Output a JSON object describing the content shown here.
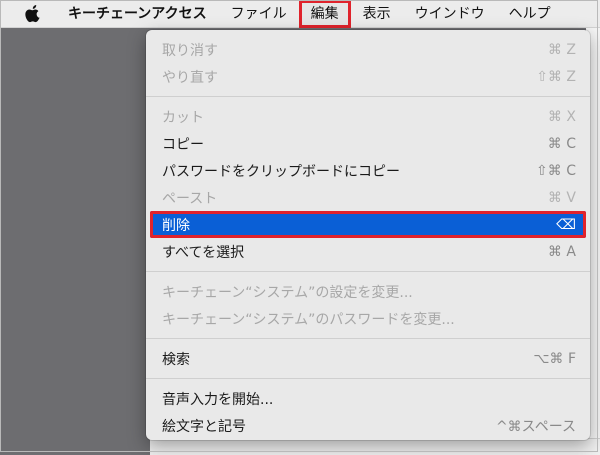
{
  "menubar": {
    "app_name": "キーチェーンアクセス",
    "menus": [
      "ファイル",
      "編集",
      "表示",
      "ウインドウ",
      "ヘルプ"
    ],
    "active_menu": "編集"
  },
  "edit_menu": {
    "undo": {
      "label": "取り消す",
      "shortcut": "⌘ Z",
      "enabled": false
    },
    "redo": {
      "label": "やり直す",
      "shortcut": "⇧⌘ Z",
      "enabled": false
    },
    "cut": {
      "label": "カット",
      "shortcut": "⌘ X",
      "enabled": false
    },
    "copy": {
      "label": "コピー",
      "shortcut": "⌘ C",
      "enabled": true
    },
    "copy_password": {
      "label": "パスワードをクリップボードにコピー",
      "shortcut": "⇧⌘ C",
      "enabled": true
    },
    "paste": {
      "label": "ペースト",
      "shortcut": "⌘ V",
      "enabled": false
    },
    "delete": {
      "label": "削除",
      "shortcut": "⌫",
      "enabled": true,
      "highlighted": true
    },
    "select_all": {
      "label": "すべてを選択",
      "shortcut": "⌘ A",
      "enabled": true
    },
    "change_settings": {
      "label": "キーチェーン“システム”の設定を変更...",
      "enabled": false
    },
    "change_password": {
      "label": "キーチェーン“システム”のパスワードを変更...",
      "enabled": false
    },
    "find": {
      "label": "検索",
      "shortcut": "⌥⌘ F",
      "enabled": true
    },
    "start_dictation": {
      "label": "音声入力を開始...",
      "enabled": true
    },
    "emoji_symbols": {
      "label": "絵文字と記号",
      "shortcut": "^⌘スペース",
      "enabled": true
    }
  },
  "colors": {
    "highlight": "#0a5fd6",
    "annotation": "#e0232c"
  }
}
